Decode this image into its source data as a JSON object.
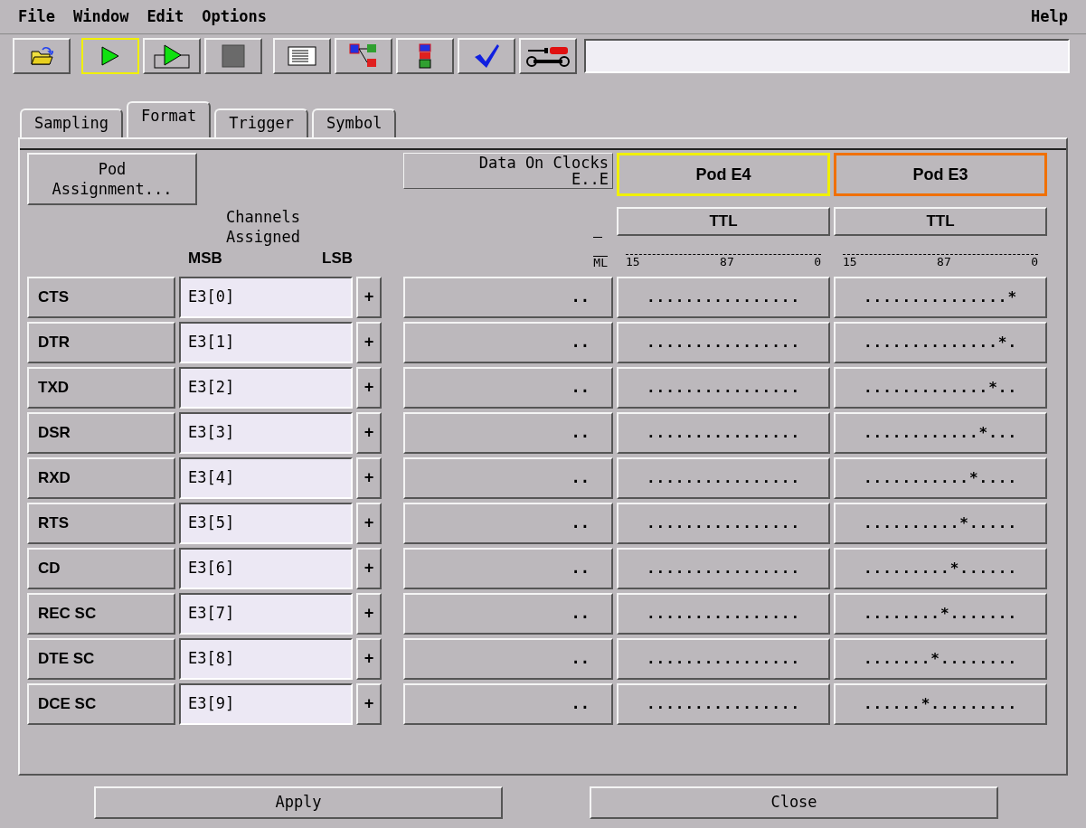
{
  "menu_bar": {
    "left": [
      "File",
      "Window",
      "Edit",
      "Options"
    ],
    "right": [
      "Help"
    ]
  },
  "toolbar": [
    {
      "kind": "open",
      "highlighted": false
    },
    {
      "kind": "run",
      "highlighted": true
    },
    {
      "kind": "repetitive",
      "highlighted": false
    },
    {
      "kind": "stop",
      "highlighted": false
    },
    {
      "kind": "list",
      "highlighted": false
    },
    {
      "kind": "tree",
      "highlighted": false
    },
    {
      "kind": "module",
      "highlighted": false
    },
    {
      "kind": "check",
      "highlighted": false
    },
    {
      "kind": "tools",
      "highlighted": false
    }
  ],
  "tabs": [
    {
      "label": "Sampling",
      "selected": false
    },
    {
      "label": "Format",
      "selected": true
    },
    {
      "label": "Trigger",
      "selected": false
    },
    {
      "label": "Symbol",
      "selected": false
    }
  ],
  "pod_assignment_button": "Pod\nAssignment...",
  "channels_header": "Channels\nAssigned",
  "msb": "MSB",
  "lsb": "LSB",
  "clocks_button": "Data On Clocks\nE..E",
  "clocks_bits": "ML",
  "pods": [
    {
      "label": "Pod E4",
      "color": "#f0f000",
      "threshold": "TTL",
      "bit_labels": [
        "15",
        "87",
        "0"
      ]
    },
    {
      "label": "Pod E3",
      "color": "#f07000",
      "threshold": "TTL",
      "bit_labels": [
        "15",
        "87",
        "0"
      ]
    }
  ],
  "rows": [
    {
      "label": "CTS",
      "channels": "E3[0]",
      "add": "+",
      "clocks": "..",
      "pods": [
        "................",
        "...............*"
      ]
    },
    {
      "label": "DTR",
      "channels": "E3[1]",
      "add": "+",
      "clocks": "..",
      "pods": [
        "................",
        "..............*."
      ]
    },
    {
      "label": "TXD",
      "channels": "E3[2]",
      "add": "+",
      "clocks": "..",
      "pods": [
        "................",
        ".............*.."
      ]
    },
    {
      "label": "DSR",
      "channels": "E3[3]",
      "add": "+",
      "clocks": "..",
      "pods": [
        "................",
        "............*..."
      ]
    },
    {
      "label": "RXD",
      "channels": "E3[4]",
      "add": "+",
      "clocks": "..",
      "pods": [
        "................",
        "...........*...."
      ]
    },
    {
      "label": "RTS",
      "channels": "E3[5]",
      "add": "+",
      "clocks": "..",
      "pods": [
        "................",
        "..........*....."
      ]
    },
    {
      "label": "CD",
      "channels": "E3[6]",
      "add": "+",
      "clocks": "..",
      "pods": [
        "................",
        ".........*......"
      ]
    },
    {
      "label": "REC SC",
      "channels": "E3[7]",
      "add": "+",
      "clocks": "..",
      "pods": [
        "................",
        "........*......."
      ]
    },
    {
      "label": "DTE SC",
      "channels": "E3[8]",
      "add": "+",
      "clocks": "..",
      "pods": [
        "................",
        ".......*........"
      ]
    },
    {
      "label": "DCE SC",
      "channels": "E3[9]",
      "add": "+",
      "clocks": "..",
      "pods": [
        "................",
        "......*........."
      ]
    }
  ],
  "bottom_buttons": [
    "Apply",
    "Close"
  ]
}
